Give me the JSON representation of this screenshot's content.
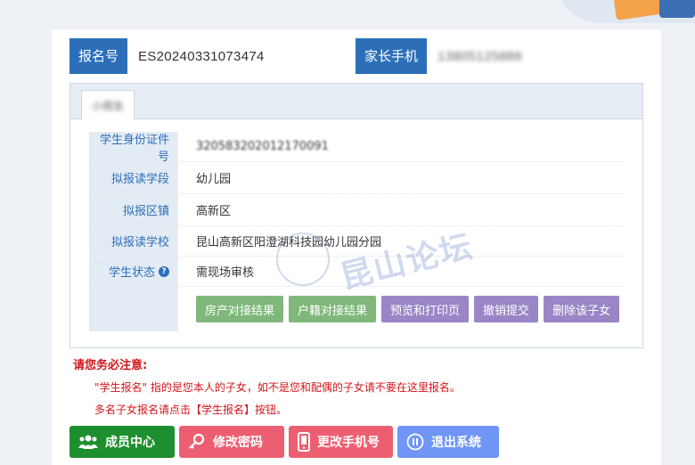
{
  "header": {
    "reg_no_label": "报名号",
    "reg_no_value": "ES20240331073474",
    "parent_phone_label": "家长手机",
    "parent_phone_value": "13805125886"
  },
  "tab": {
    "label": "小朋友"
  },
  "student": {
    "fields": [
      {
        "label": "学生身份证件号",
        "value": "320583202012170091"
      },
      {
        "label": "拟报读学段",
        "value": "幼儿园"
      },
      {
        "label": "拟报区镇",
        "value": "高新区"
      },
      {
        "label": "拟报读学校",
        "value": "昆山高新区阳澄湖科技园幼儿园分园"
      },
      {
        "label": "学生状态",
        "value": "需现场审核"
      }
    ],
    "actions": [
      "房产对接结果",
      "户籍对接结果",
      "预览和打印页",
      "撤销提交",
      "删除该子女"
    ]
  },
  "watermark": {
    "text": "昆山论坛"
  },
  "notice": {
    "title": "请您务必注意:",
    "line1": "\"学生报名\" 指的是您本人的子女，如不是您和配偶的子女请不要在这里报名。",
    "line2": "多名子女报名请点击【学生报名】按钮。"
  },
  "bottom_buttons": {
    "member_center": "成员中心",
    "change_password": "修改密码",
    "change_phone": "更改手机号",
    "logout": "退出系统"
  },
  "colors": {
    "primary_blue": "#2c6fb8",
    "green_action": "#7fb87a",
    "purple_action": "#9a86c6",
    "notice_red": "#d2161b",
    "member_green": "#1e8f2e",
    "pink": "#ec5f72",
    "logout_blue": "#6f95f5"
  }
}
